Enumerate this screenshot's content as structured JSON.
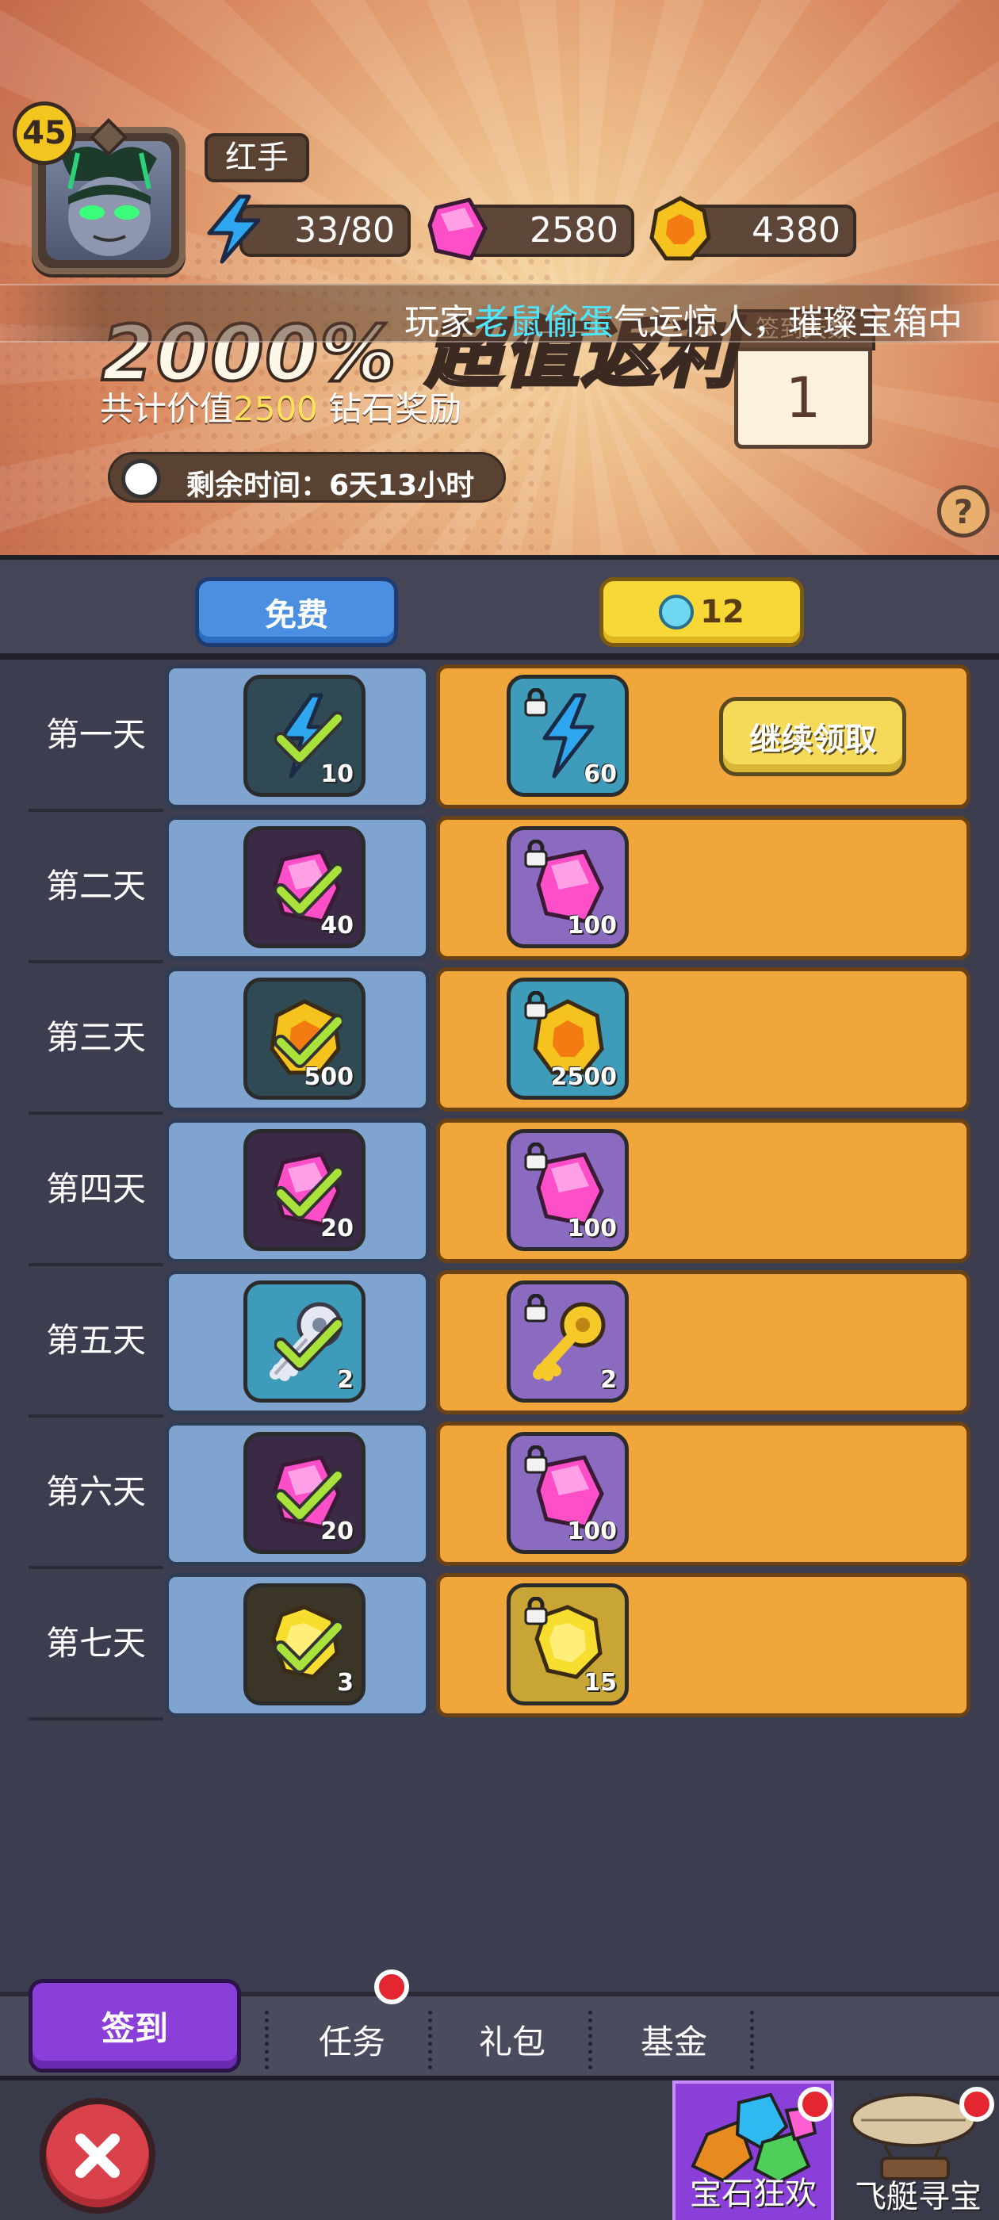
{
  "player": {
    "level": "45",
    "name": "红手"
  },
  "resources": {
    "energy": "33/80",
    "gems": "2580",
    "coins": "4380"
  },
  "ticker": {
    "prefix": "玩家",
    "highlight": "老鼠偷蛋",
    "suffix": "气运惊人，璀璨宝箱中"
  },
  "promo": {
    "title": "2000% 超值返利",
    "sub_prefix": "共计价值",
    "sub_value": "2500",
    "sub_suffix": " 钻石奖励",
    "timer": "剩余时间：6天13小时",
    "counter_label": "签到天数",
    "counter_value": "1",
    "help": "?"
  },
  "tiers": {
    "free_label": "免费",
    "paid_label": "12"
  },
  "days": [
    {
      "label": "第一天",
      "free": {
        "icon": "energy-icon",
        "count": "10",
        "bg": "bg-dark-teal"
      },
      "paid": {
        "icon": "energy-icon",
        "count": "60",
        "bg": "bg-teal"
      },
      "claim": "继续领取"
    },
    {
      "label": "第二天",
      "free": {
        "icon": "gem-icon",
        "count": "40",
        "bg": "bg-dark-purple"
      },
      "paid": {
        "icon": "gem-icon",
        "count": "100",
        "bg": "bg-purple"
      }
    },
    {
      "label": "第三天",
      "free": {
        "icon": "coin-icon",
        "count": "500",
        "bg": "bg-dark-teal"
      },
      "paid": {
        "icon": "coin-icon",
        "count": "2500",
        "bg": "bg-teal"
      }
    },
    {
      "label": "第四天",
      "free": {
        "icon": "gem-icon",
        "count": "20",
        "bg": "bg-dark-purple"
      },
      "paid": {
        "icon": "gem-icon",
        "count": "100",
        "bg": "bg-purple"
      }
    },
    {
      "label": "第五天",
      "free": {
        "icon": "silver-key-icon",
        "count": "2",
        "bg": "bg-teal"
      },
      "paid": {
        "icon": "gold-key-icon",
        "count": "2",
        "bg": "bg-purple"
      }
    },
    {
      "label": "第六天",
      "free": {
        "icon": "gem-icon",
        "count": "20",
        "bg": "bg-dark-purple"
      },
      "paid": {
        "icon": "gem-icon",
        "count": "100",
        "bg": "bg-purple"
      }
    },
    {
      "label": "第七天",
      "free": {
        "icon": "gold-gem-icon",
        "count": "3",
        "bg": "bg-dark-olive"
      },
      "paid": {
        "icon": "gold-gem-icon",
        "count": "15",
        "bg": "bg-gold"
      }
    }
  ],
  "tabs": {
    "signin": "签到",
    "tasks": "任务",
    "gifts": "礼包",
    "fund": "基金"
  },
  "shortcuts": {
    "gem_carnival": "宝石狂欢",
    "airship": "飞艇寻宝"
  }
}
